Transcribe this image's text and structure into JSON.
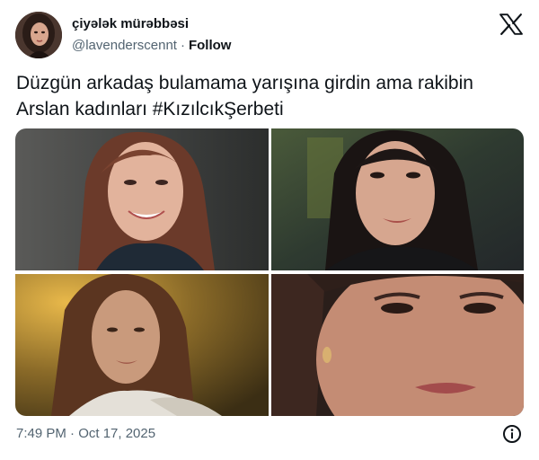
{
  "author": {
    "display_name": "çiyələk mürəbbəsi",
    "handle": "@lavenderscennt",
    "separator": "·",
    "follow_label": "Follow",
    "avatar_icon": "profile-photo"
  },
  "brand": {
    "logo_icon": "x-logo-icon"
  },
  "tweet": {
    "text_line_1": "Düzgün arkadaş bulamama yarışına girdin ama rakibin",
    "text_line_2": "Arslan kadınları #KızılcıkŞerbeti"
  },
  "media": {
    "photos": [
      {
        "subject": "smiling woman with long auburn hair"
      },
      {
        "subject": "woman with dark hair, serious look"
      },
      {
        "subject": "woman with long brown hair, warm light"
      },
      {
        "subject": "close-up of woman with earring"
      }
    ]
  },
  "footer": {
    "timestamp": "7:49 PM · Oct 17, 2025",
    "info_icon": "info-icon"
  },
  "colors": {
    "text": "#0f1419",
    "secondary_text": "#536471",
    "background": "#ffffff"
  }
}
